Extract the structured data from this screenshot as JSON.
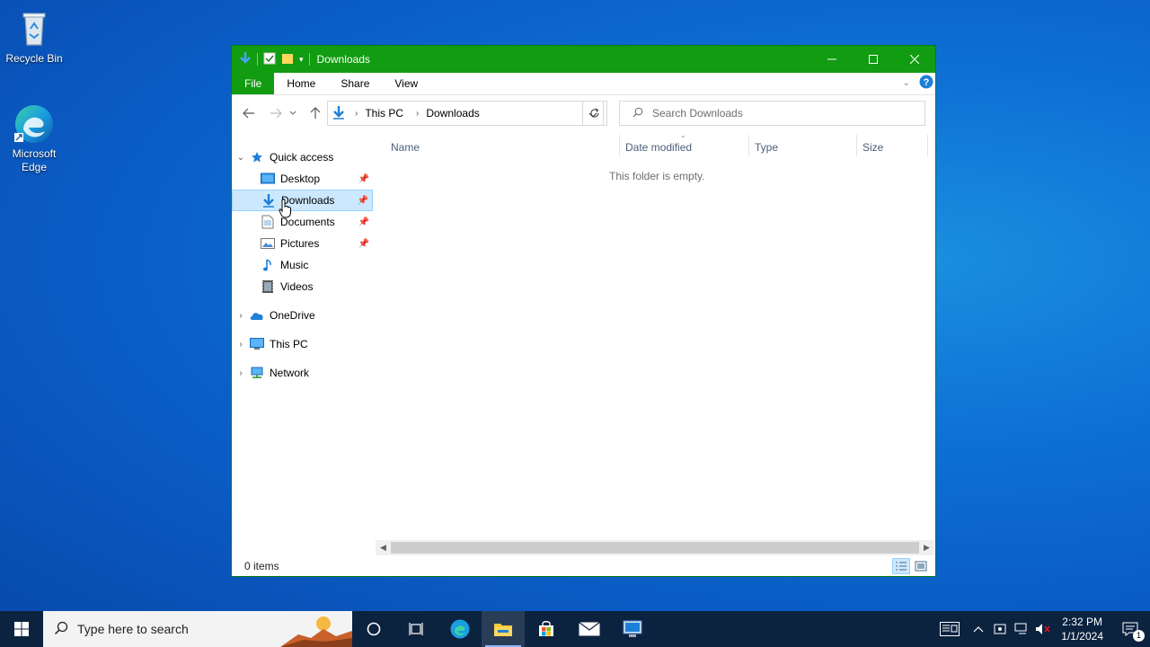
{
  "desktop": {
    "icons": [
      {
        "label": "Recycle Bin"
      },
      {
        "label": "Microsoft Edge"
      }
    ]
  },
  "window": {
    "title": "Downloads",
    "ribbon_tabs": {
      "file": "File",
      "home": "Home",
      "share": "Share",
      "view": "View"
    },
    "address": {
      "crumbs": [
        "This PC",
        "Downloads"
      ]
    },
    "search": {
      "placeholder": "Search Downloads"
    },
    "nav": {
      "quick_access": "Quick access",
      "desktop": "Desktop",
      "downloads": "Downloads",
      "documents": "Documents",
      "pictures": "Pictures",
      "music": "Music",
      "videos": "Videos",
      "onedrive": "OneDrive",
      "this_pc": "This PC",
      "network": "Network"
    },
    "columns": {
      "name": "Name",
      "date_modified": "Date modified",
      "type": "Type",
      "size": "Size"
    },
    "empty_message": "This folder is empty.",
    "status": {
      "item_count": "0 items"
    }
  },
  "taskbar": {
    "search_placeholder": "Type here to search",
    "clock": {
      "time": "2:32 PM",
      "date": "1/1/2024"
    },
    "notification_count": "1"
  },
  "colors": {
    "titlebar": "#119c11",
    "selection": "#cce8ff",
    "taskbar": "#0c2340",
    "accent_blue": "#1e7fd8"
  }
}
